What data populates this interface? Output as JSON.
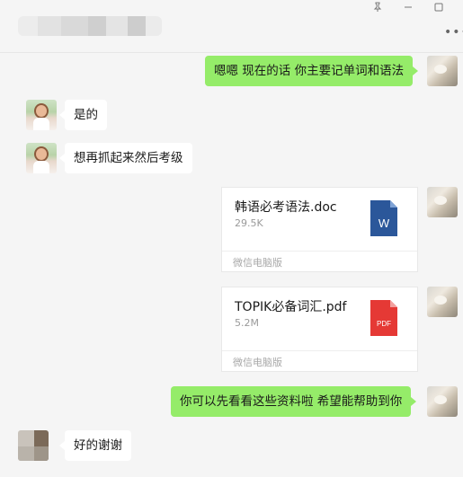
{
  "window": {
    "icons": [
      "pin-icon",
      "minimize-icon",
      "maximize-icon",
      "more-icon"
    ]
  },
  "messages": [
    {
      "type": "text",
      "direction": "out",
      "text": "嗯嗯 现在的话 你主要记单词和语法"
    },
    {
      "type": "text",
      "direction": "in",
      "text": "是的"
    },
    {
      "type": "text",
      "direction": "in",
      "text": "想再抓起来然后考级"
    },
    {
      "type": "file",
      "direction": "out",
      "name": "韩语必考语法.doc",
      "size": "29.5K",
      "source": "微信电脑版",
      "icon": "word-file-icon",
      "icon_label": "W",
      "icon_color": "#2b579a"
    },
    {
      "type": "file",
      "direction": "out",
      "name": "TOPIK必备词汇.pdf",
      "size": "5.2M",
      "source": "微信电脑版",
      "icon": "pdf-file-icon",
      "icon_label": "PDF",
      "icon_color": "#e53935"
    },
    {
      "type": "text",
      "direction": "out",
      "text": "你可以先看看这些资料啦 希望能帮助到你"
    },
    {
      "type": "text",
      "direction": "in",
      "text": "好的谢谢"
    }
  ],
  "colors": {
    "outgoing_bubble": "#95ec69",
    "incoming_bubble": "#ffffff",
    "background": "#f5f5f5"
  }
}
